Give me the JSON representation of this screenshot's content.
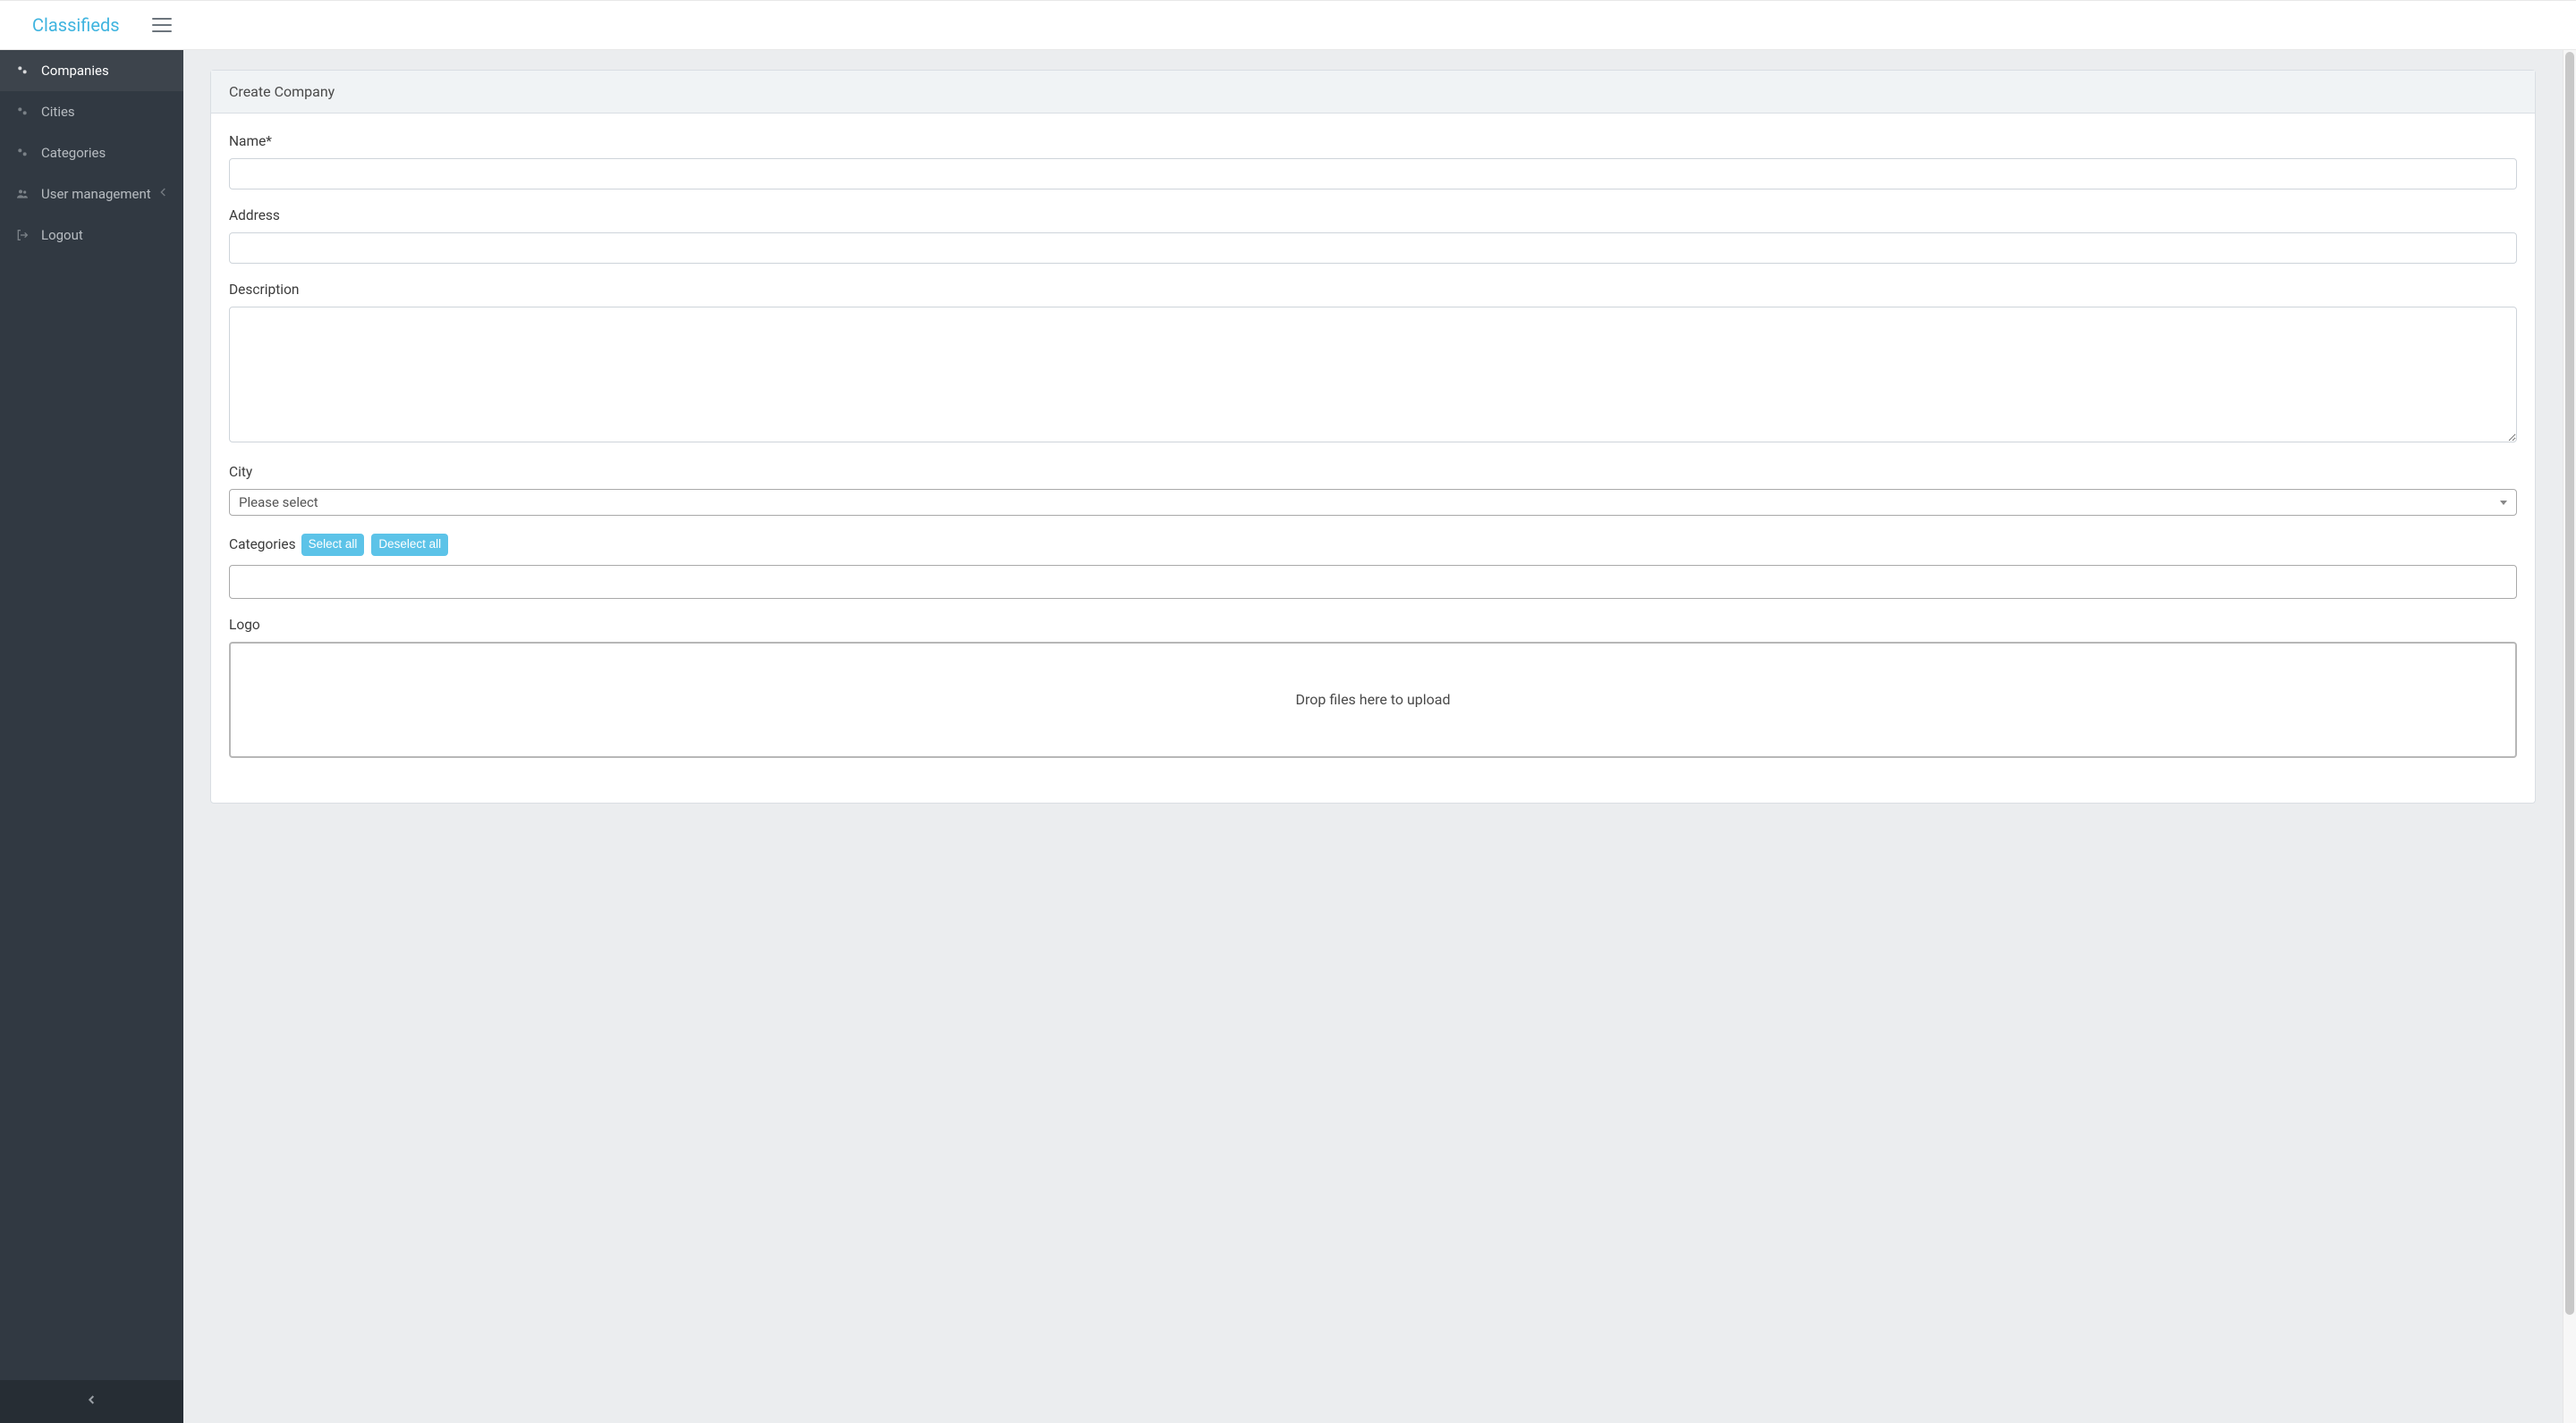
{
  "brand": "Classifieds",
  "sidebar": {
    "items": [
      {
        "label": "Companies",
        "icon": "cogs-icon",
        "active": true
      },
      {
        "label": "Cities",
        "icon": "cogs-icon"
      },
      {
        "label": "Categories",
        "icon": "cogs-icon"
      },
      {
        "label": "User management",
        "icon": "users-icon",
        "expandable": true
      },
      {
        "label": "Logout",
        "icon": "logout-icon"
      }
    ]
  },
  "card": {
    "title": "Create Company"
  },
  "form": {
    "name_label": "Name*",
    "name_value": "",
    "address_label": "Address",
    "address_value": "",
    "description_label": "Description",
    "description_value": "",
    "city_label": "City",
    "city_placeholder": "Please select",
    "categories_label": "Categories",
    "select_all_label": "Select all",
    "deselect_all_label": "Deselect all",
    "logo_label": "Logo",
    "dropzone_text": "Drop files here to upload"
  },
  "colors": {
    "accent": "#3fb4df",
    "info": "#5cc3e8",
    "sidebar": "#313942"
  }
}
